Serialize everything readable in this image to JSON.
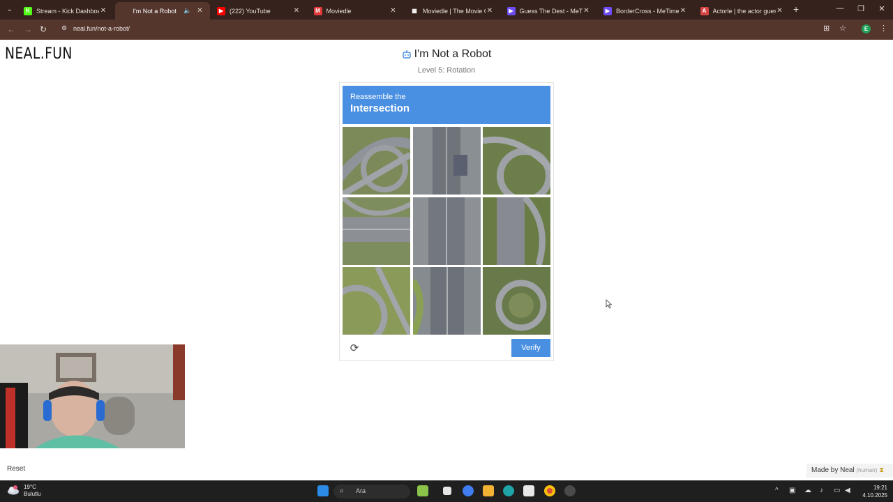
{
  "browser": {
    "tabs": [
      {
        "title": "Stream - Kick Dashboard",
        "icon": "kick-icon",
        "color": "#53fc18",
        "glyph": "K",
        "active": false
      },
      {
        "title": "I'm Not a Robot",
        "icon": "robot-icon",
        "color": "#54362d",
        "glyph": "",
        "active": true
      },
      {
        "title": "(222) YouTube",
        "icon": "youtube-icon",
        "color": "#ff0000",
        "glyph": "▶",
        "active": false
      },
      {
        "title": "Moviedle",
        "icon": "moviedle-icon",
        "color": "#e03a3a",
        "glyph": "M",
        "active": false
      },
      {
        "title": "Moviedle | The Movie Gu",
        "icon": "film-icon",
        "color": "#35221c",
        "glyph": "▦",
        "active": false
      },
      {
        "title": "Guess The Dest - MeTime",
        "icon": "metime-icon",
        "color": "#6c4cf5",
        "glyph": "▶",
        "active": false
      },
      {
        "title": "BorderCross - MeTime.Ga",
        "icon": "metime-icon",
        "color": "#6c4cf5",
        "glyph": "▶",
        "active": false
      },
      {
        "title": "Actorle | the actor guessi",
        "icon": "actorle-icon",
        "color": "#d64545",
        "glyph": "A",
        "active": false
      }
    ],
    "url": "neal.fun/not-a-robot/",
    "profile_initial": "E"
  },
  "page": {
    "logo": "NEAL.FUN",
    "title": "I'm Not a Robot",
    "subtitle": "Level 5: Rotation",
    "captcha": {
      "instruction_small": "Reassemble the",
      "instruction_big": "Intersection",
      "verify_label": "Verify",
      "accent": "#4a90e2"
    },
    "reset_label": "Reset",
    "made_by": "Made by Neal",
    "made_by_tag": "(human)"
  },
  "taskbar": {
    "weather_temp": "19°C",
    "weather_desc": "Bulutlu",
    "search_placeholder": "Ara",
    "time": "19:21",
    "date": "4.10.2025"
  }
}
